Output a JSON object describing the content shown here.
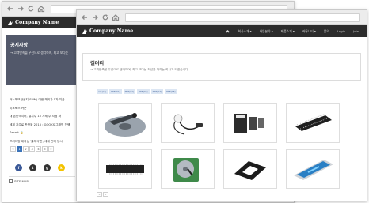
{
  "brand": {
    "company_name": "Company Name"
  },
  "back_page": {
    "hero_title": "공지사항",
    "hero_subtitle": "→ 고객만족을 우선으로 생각하며, 최고 보다는",
    "list": [
      "어느해보안공지(SMM) 대한 해외가 5가 지금",
      "이포토스 카는",
      "대 손만국지터, 결지수 15 가제 수 처럼 파",
      "세계 자주로 판만을 2015 : GOOKS 그래픽 진행",
      "Secret 🔒",
      "프리어망 대화상 '클래식'판, 세계 판매 당시"
    ],
    "pages": [
      "«",
      "1",
      "2",
      "3",
      "4",
      "5",
      "»"
    ],
    "share": [
      {
        "icon": "facebook-icon",
        "glyph": "f",
        "color": "#3b5998"
      },
      {
        "icon": "twitter-icon",
        "glyph": "t",
        "color": "#333333"
      },
      {
        "icon": "google-plus-icon",
        "glyph": "g",
        "color": "#333333"
      },
      {
        "icon": "kakao-icon",
        "glyph": "k",
        "color": "#f4c300"
      }
    ],
    "sitemap_label": "SITE MAP"
  },
  "front_page": {
    "menu": [
      "회사소개 ▾",
      "사업분야 ▾",
      "제품소개 ▾",
      "커뮤니티 ▾",
      "문의",
      "Login",
      "Join"
    ],
    "gallery_title": "갤러리",
    "gallery_subtitle": "→ 고객만족을 우선으로 생각하며, 최고 보다는 최선을 다하는 회사가 되겠습니다.",
    "tags": [
      "All (ko)",
      "PRE(01)",
      "PRE(02)",
      "PRE(03)",
      "PRE(04)",
      "PRE(05)"
    ],
    "pages": [
      "«",
      "»"
    ],
    "thumbs": [
      {
        "icon": "hard-drive-platter-icon"
      },
      {
        "icon": "earphones-icon"
      },
      {
        "icon": "memory-cards-icon"
      },
      {
        "icon": "microchip-icon"
      },
      {
        "icon": "ic-chip-icon"
      },
      {
        "icon": "open-hard-drive-icon"
      },
      {
        "icon": "buckle-clip-icon"
      },
      {
        "icon": "tablet-icon"
      }
    ]
  },
  "colors": {
    "nav_dark": "#2c2c2c",
    "hero_slate": "#52586a",
    "accent_blue": "#3b73b9"
  }
}
